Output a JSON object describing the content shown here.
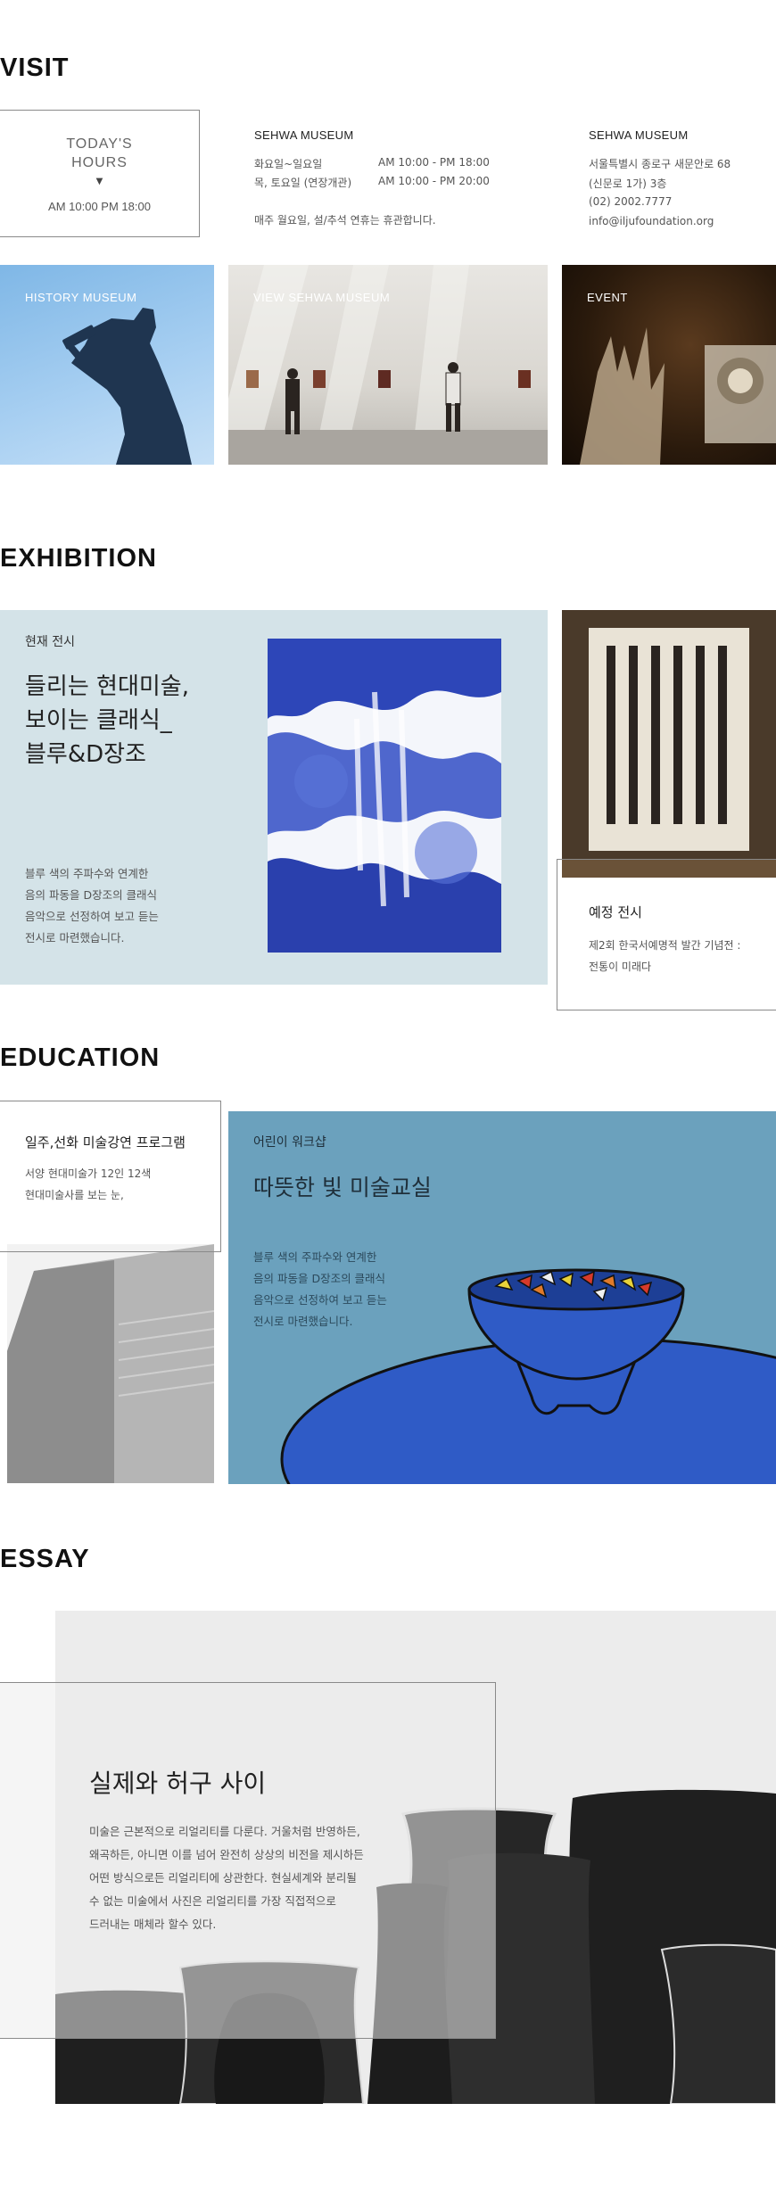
{
  "visit": {
    "section_title": "VISIT",
    "hours": {
      "title_line1": "TODAY'S",
      "title_line2": "HOURS",
      "caret": "▼",
      "time": "AM 10:00 PM 18:00"
    },
    "schedule": {
      "title": "SEHWA MUSEUM",
      "row1_days": "화요일~일요일",
      "row1_time": "AM 10:00 - PM 18:00",
      "row2_days": "목, 토요일 (연장개관)",
      "row2_time": "AM 10:00 - PM 20:00",
      "closed_note": "매주 월요일, 설/추석 연휴는 휴관합니다."
    },
    "contact": {
      "title": "SEHWA MUSEUM",
      "address1": "서울특별시 종로구 새문안로 68",
      "address2": "(신문로 1가) 3층",
      "phone": "(02) 2002.7777",
      "email": "info@iljufoundation.org"
    },
    "tiles": [
      {
        "label": "HISTORY MUSEUM",
        "icon": "hammering-man-sculpture"
      },
      {
        "label": "VIEW SEHWA MUSEUM",
        "icon": "gallery-visitors"
      },
      {
        "label": "EVENT",
        "icon": "sculpture-display"
      }
    ]
  },
  "exhibition": {
    "section_title": "EXHIBITION",
    "current": {
      "sub": "현재 전시",
      "title_line1": "들리는 현대미술,",
      "title_line2": "보이는 클래식_",
      "title_line3": "블루&D장조",
      "desc_line1": "블루 색의 주파수와 연계한",
      "desc_line2": "음의 파동을 D장조의 클래식",
      "desc_line3": "음악으로 선정하여 보고 듣는",
      "desc_line4": "전시로 마련했습니다."
    },
    "upcoming": {
      "title": "예정 전시",
      "desc_line1": "제2회 한국서예명적 발간 기념전 :",
      "desc_line2": "전통이 미래다"
    }
  },
  "education": {
    "section_title": "EDUCATION",
    "lecture": {
      "title": "일주,선화 미술강연 프로그램",
      "desc_line1": "서양 현대미술가 12인 12색",
      "desc_line2": "현대미술사를 보는 눈,"
    },
    "workshop": {
      "sub": "어린이 워크샵",
      "title": "따뜻한 빛 미술교실",
      "desc_line1": "블루 색의 주파수와 연계한",
      "desc_line2": "음의 파동을 D장조의 클래식",
      "desc_line3": "음악으로 선정하여 보고 듣는",
      "desc_line4": "전시로 마련했습니다."
    }
  },
  "essay": {
    "section_title": "ESSAY",
    "title": "실제와 허구 사이",
    "text_line1": "미술은 근본적으로 리얼리티를 다룬다. 거울처럼 반영하든,",
    "text_line2": "왜곡하든, 아니면 이를 넘어 완전히 상상의 비전을 제시하든",
    "text_line3": "어떤 방식으로든 리얼리티에 상관한다. 현실세계와 분리될",
    "text_line4": "수 없는 미술에서 사진은 리얼리티를 가장 직접적으로",
    "text_line5": "드러내는 매체라 할수 있다."
  },
  "colors": {
    "exhibition_bg": "#d4e3e8",
    "workshop_bg": "#6ba1bd",
    "essay_bg": "#ececec",
    "box_border": "#8a8a8a"
  }
}
